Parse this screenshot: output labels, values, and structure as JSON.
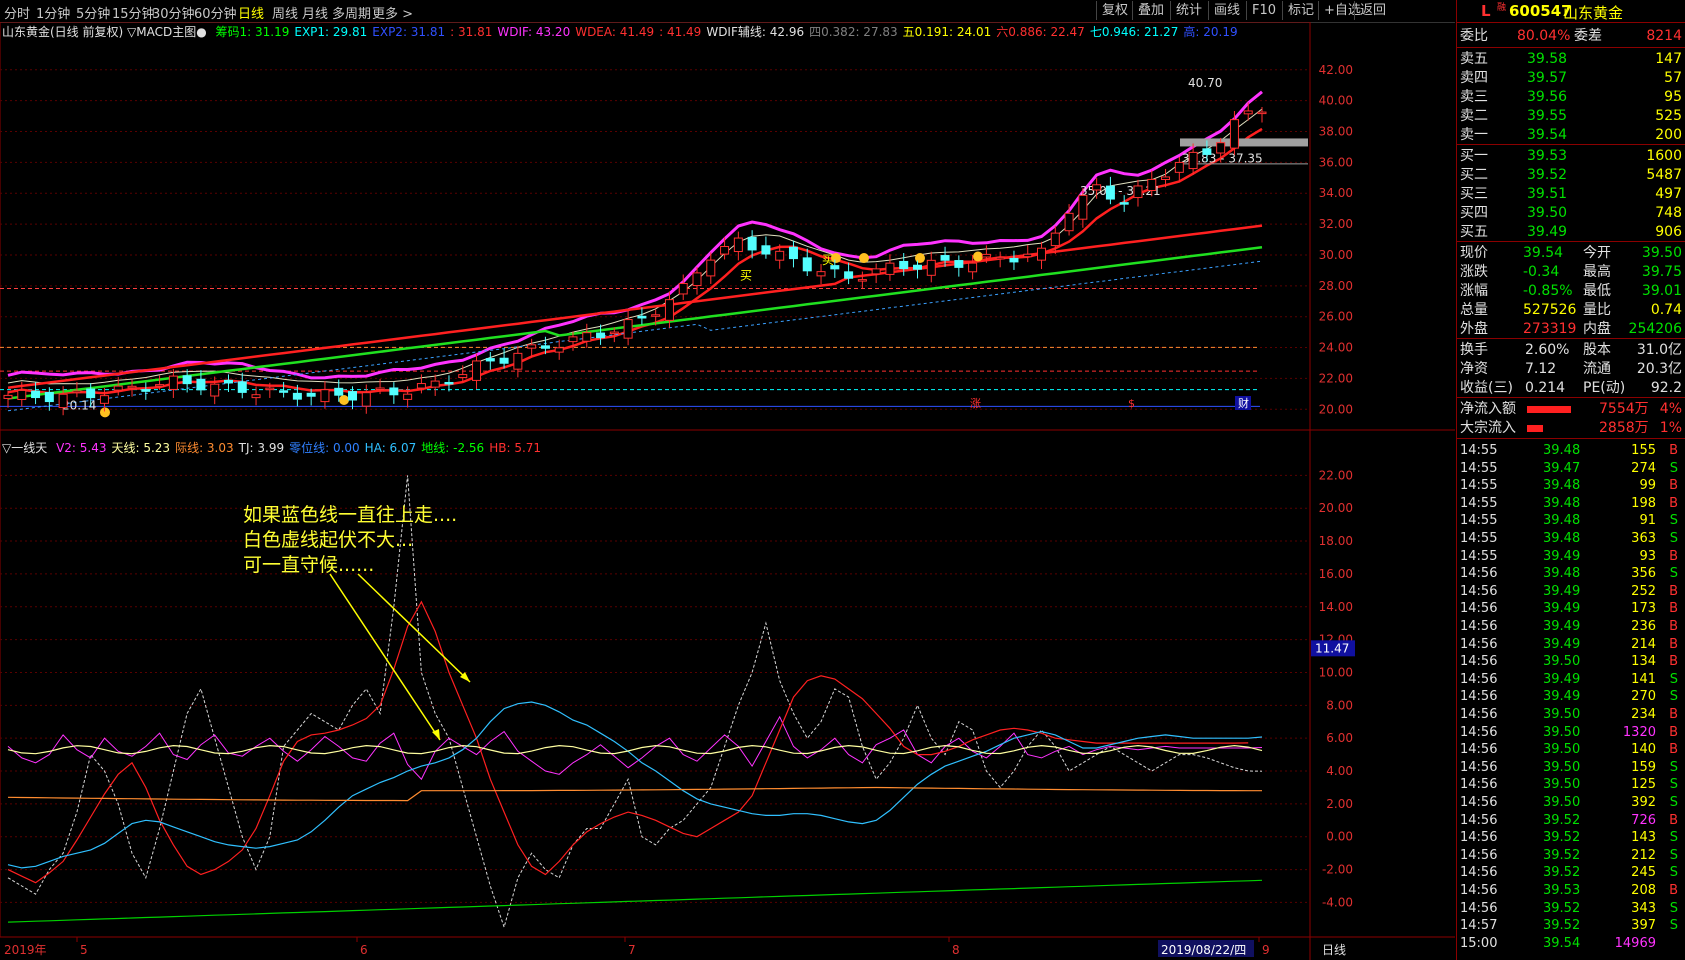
{
  "toolbar": {
    "periods": [
      "分时",
      "1分钟",
      "5分钟",
      "15分钟",
      "30分钟",
      "60分钟",
      "日线",
      "周线",
      "月线",
      "多周期",
      "更多 >"
    ],
    "active_period": "日线",
    "right_buttons": [
      "复权",
      "叠加",
      "统计",
      "画线",
      "F10",
      "标记",
      "+自选",
      "返回"
    ]
  },
  "main_chart": {
    "title_left": "山东黄金(日线 前复权)",
    "indicator_name": "▽MACD主图●",
    "legend": [
      {
        "label": "筹码1: 31.19",
        "color": "#00ff00"
      },
      {
        "label": "EXP1: 29.81",
        "color": "#00ffff"
      },
      {
        "label": "EXP2: 31.81",
        "color": "#3050ff"
      },
      {
        "label": ": 31.81",
        "color": "#ff3030"
      },
      {
        "label": "WDIF: 43.20",
        "color": "#ff33ff"
      },
      {
        "label": "WDEA: 41.49",
        "color": "#ff3030"
      },
      {
        "label": ": 41.49",
        "color": "#ff3030"
      },
      {
        "label": "WDIF辅线: 42.96",
        "color": "#e0e0e0"
      },
      {
        "label": "四0.382: 27.83",
        "color": "#808080"
      },
      {
        "label": "五0.191: 24.01",
        "color": "#ffff00"
      },
      {
        "label": "六0.886: 22.47",
        "color": "#ff3030"
      },
      {
        "label": "七0.946: 21.27",
        "color": "#00ffff"
      },
      {
        "label": "高: 20.19",
        "color": "#3050ff"
      }
    ],
    "y_ticks": [
      "42.00",
      "40.00",
      "38.00",
      "36.00",
      "34.00",
      "32.00",
      "30.00",
      "28.00",
      "26.00",
      "24.00",
      "22.00",
      "20.00"
    ],
    "price_labels": {
      "high": "40.70",
      "band1": "36.83 - 37.35",
      "band2": "35.08 - 35.21",
      "low": "20.14"
    },
    "markers": {
      "buy1": "买",
      "buy2": "买",
      "zhang": "涨",
      "dollar": "$",
      "cai": "财"
    }
  },
  "sub_chart": {
    "indicator_name": "▽一线天",
    "legend": [
      {
        "label": "V2: 5.43",
        "color": "#ff33ff"
      },
      {
        "label": "天线: 5.23",
        "color": "#ffffa0"
      },
      {
        "label": "际线: 3.03",
        "color": "#ff8c30"
      },
      {
        "label": "TJ: 3.99",
        "color": "#e0e0e0"
      },
      {
        "label": "零位线: 0.00",
        "color": "#3080ff"
      },
      {
        "label": "HA: 6.07",
        "color": "#30c0ff"
      },
      {
        "label": "地线: -2.56",
        "color": "#00ff00"
      },
      {
        "label": "HB: 5.71",
        "color": "#ff3030"
      }
    ],
    "y_ticks": [
      "22.00",
      "20.00",
      "18.00",
      "16.00",
      "14.00",
      "12.00",
      "10.00",
      "8.00",
      "6.00",
      "4.00",
      "2.00",
      "0.00",
      "-2.00",
      "-4.00"
    ],
    "current_value": "11.47",
    "annotation": [
      "如果蓝色线一直往上走....",
      "白色虚线起伏不大...",
      "可一直守候......"
    ]
  },
  "x_axis": {
    "labels": [
      "2019年",
      "5",
      "6",
      "7",
      "8",
      "9"
    ],
    "date_cursor": "2019/08/22/四",
    "period_label": "日线"
  },
  "quote": {
    "header": {
      "flag": "L",
      "tag": "融",
      "code": "600547",
      "name": "山东黄金"
    },
    "weibi": {
      "label": "委比",
      "value": "80.04%",
      "label2": "委差",
      "value2": "8214"
    },
    "asks": [
      {
        "label": "卖五",
        "price": "39.58",
        "vol": "147"
      },
      {
        "label": "卖四",
        "price": "39.57",
        "vol": "57"
      },
      {
        "label": "卖三",
        "price": "39.56",
        "vol": "95"
      },
      {
        "label": "卖二",
        "price": "39.55",
        "vol": "525"
      },
      {
        "label": "卖一",
        "price": "39.54",
        "vol": "200"
      }
    ],
    "bids": [
      {
        "label": "买一",
        "price": "39.53",
        "vol": "1600"
      },
      {
        "label": "买二",
        "price": "39.52",
        "vol": "5487"
      },
      {
        "label": "买三",
        "price": "39.51",
        "vol": "497"
      },
      {
        "label": "买四",
        "price": "39.50",
        "vol": "748"
      },
      {
        "label": "买五",
        "price": "39.49",
        "vol": "906"
      }
    ],
    "stats": [
      {
        "l1": "现价",
        "v1": "39.54",
        "c1": "grn",
        "l2": "今开",
        "v2": "39.50",
        "c2": "grn"
      },
      {
        "l1": "涨跌",
        "v1": "-0.34",
        "c1": "grn",
        "l2": "最高",
        "v2": "39.75",
        "c2": "grn"
      },
      {
        "l1": "涨幅",
        "v1": "-0.85%",
        "c1": "grn",
        "l2": "最低",
        "v2": "39.01",
        "c2": "grn"
      },
      {
        "l1": "总量",
        "v1": "527526",
        "c1": "yel",
        "l2": "量比",
        "v2": "0.74",
        "c2": "yel"
      },
      {
        "l1": "外盘",
        "v1": "273319",
        "c1": "red",
        "l2": "内盘",
        "v2": "254206",
        "c2": "grn"
      }
    ],
    "stats2": [
      {
        "l1": "换手",
        "v1": "2.60%",
        "l2": "股本",
        "v2": "31.0亿"
      },
      {
        "l1": "净资",
        "v1": "7.12",
        "l2": "流通",
        "v2": "20.3亿"
      },
      {
        "l1": "收益(三)",
        "v1": "0.214",
        "l2": "PE(动)",
        "v2": "92.2"
      }
    ],
    "flows": [
      {
        "label": "净流入额",
        "value": "7554万",
        "pct": "4%"
      },
      {
        "label": "大宗流入",
        "value": "2858万",
        "pct": "1%"
      }
    ],
    "ticks": [
      [
        "14:55",
        "39.48",
        "155",
        "B"
      ],
      [
        "14:55",
        "39.47",
        "274",
        "S"
      ],
      [
        "14:55",
        "39.48",
        "99",
        "B"
      ],
      [
        "14:55",
        "39.48",
        "198",
        "B"
      ],
      [
        "14:55",
        "39.48",
        "91",
        "S"
      ],
      [
        "14:55",
        "39.48",
        "363",
        "S"
      ],
      [
        "14:55",
        "39.49",
        "93",
        "B"
      ],
      [
        "14:56",
        "39.48",
        "356",
        "S"
      ],
      [
        "14:56",
        "39.49",
        "252",
        "B"
      ],
      [
        "14:56",
        "39.49",
        "173",
        "B"
      ],
      [
        "14:56",
        "39.49",
        "236",
        "B"
      ],
      [
        "14:56",
        "39.49",
        "214",
        "B"
      ],
      [
        "14:56",
        "39.50",
        "134",
        "B"
      ],
      [
        "14:56",
        "39.49",
        "141",
        "S"
      ],
      [
        "14:56",
        "39.49",
        "270",
        "S"
      ],
      [
        "14:56",
        "39.50",
        "234",
        "B"
      ],
      [
        "14:56",
        "39.50",
        "1320",
        "B"
      ],
      [
        "14:56",
        "39.50",
        "140",
        "B"
      ],
      [
        "14:56",
        "39.50",
        "159",
        "S"
      ],
      [
        "14:56",
        "39.50",
        "125",
        "S"
      ],
      [
        "14:56",
        "39.50",
        "392",
        "S"
      ],
      [
        "14:56",
        "39.52",
        "726",
        "B"
      ],
      [
        "14:56",
        "39.52",
        "143",
        "S"
      ],
      [
        "14:56",
        "39.52",
        "212",
        "S"
      ],
      [
        "14:56",
        "39.52",
        "245",
        "S"
      ],
      [
        "14:56",
        "39.53",
        "208",
        "B"
      ],
      [
        "14:56",
        "39.52",
        "343",
        "S"
      ],
      [
        "14:57",
        "39.52",
        "397",
        "S"
      ],
      [
        "15:00",
        "39.54",
        "14969",
        ""
      ]
    ]
  }
}
